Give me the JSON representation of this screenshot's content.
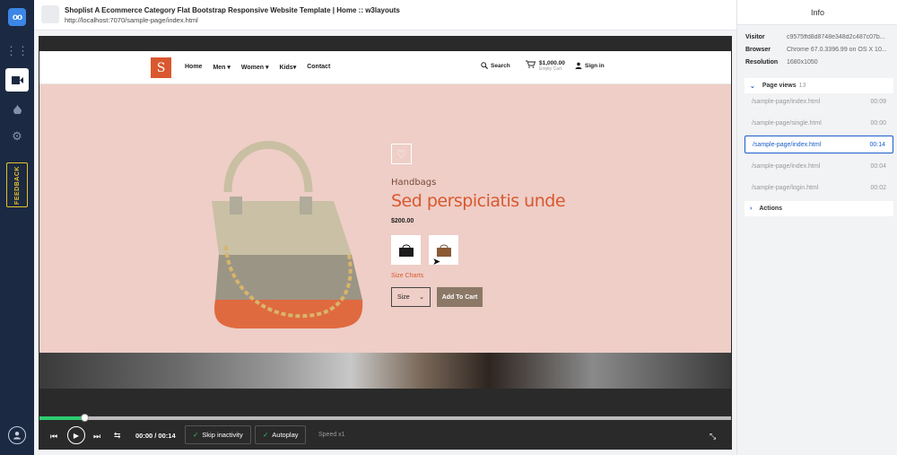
{
  "sidebar": {
    "logo_text": "oo",
    "items": [
      {
        "name": "apps-grid-icon",
        "glyph": "⋮⋮"
      },
      {
        "name": "video-camera-icon",
        "glyph": "■"
      },
      {
        "name": "drop-icon",
        "glyph": "●"
      },
      {
        "name": "gear-icon",
        "glyph": "⚙"
      }
    ],
    "feedback_label": "FEEDBACK"
  },
  "header": {
    "title": "Shoplist A Ecommerce Category Flat Bootstrap Responsive Website Template | Home :: w3layouts",
    "url": "http://localhost:7070/sample-page/index.html"
  },
  "site": {
    "logo_glyph": "S",
    "menu": [
      "Home",
      "Men ▾",
      "Women ▾",
      "Kids▾",
      "Contact"
    ],
    "search_label": "Search",
    "cart_amount": "$1,000.00",
    "cart_sub": "Empty Cart",
    "signin_label": "Sign in"
  },
  "product": {
    "category": "Handbags",
    "name": "Sed perspiciatis unde",
    "price": "$200.00",
    "size_charts_label": "Size Charts",
    "size_select": "Size",
    "add_to_cart": "Add To Cart"
  },
  "controls": {
    "time": "00:00 / 00:14",
    "skip_inactivity": "Skip inactivity",
    "autoplay": "Autoplay",
    "speed": "Speed x1",
    "progress": 0.065
  },
  "info": {
    "title": "Info",
    "visitor_label": "Visitor",
    "visitor_value": "c9575ffd8d8748e348d2c487c07b...",
    "browser_label": "Browser",
    "browser_value": "Chrome 67.0.3396.99 on OS X 10...",
    "resolution_label": "Resolution",
    "resolution_value": "1680x1050",
    "page_views_label": "Page views",
    "page_views_count": "13",
    "page_views": [
      {
        "path": "/sample-page/index.html",
        "time": "00:09",
        "active": false
      },
      {
        "path": "/sample-page/single.html",
        "time": "00:00",
        "active": false
      },
      {
        "path": "/sample-page/index.html",
        "time": "00:14",
        "active": true
      },
      {
        "path": "/sample-page/index.html",
        "time": "00:04",
        "active": false
      },
      {
        "path": "/sample-page/login.html",
        "time": "00:02",
        "active": false
      }
    ],
    "actions_label": "Actions"
  },
  "colors": {
    "rail": "#1b2942",
    "accent": "#1a5dc8",
    "brand": "#d9582f",
    "hero_bg": "#eecec7",
    "progress": "#2ecc71"
  }
}
